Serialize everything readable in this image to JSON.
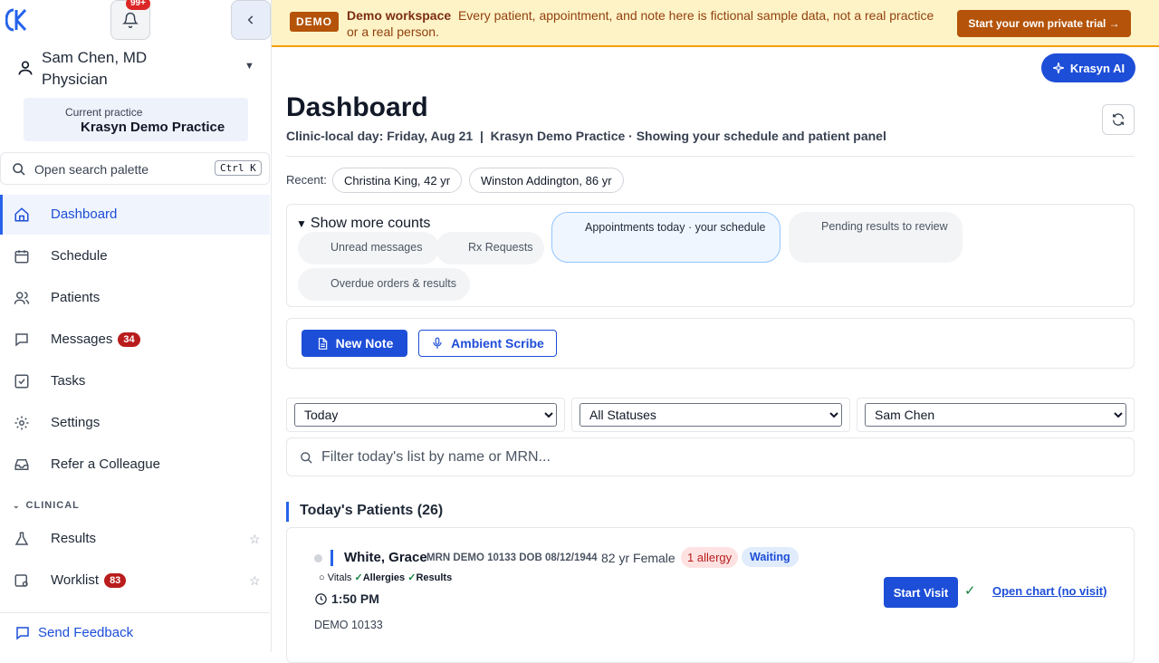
{
  "sidebar": {
    "logo": "K",
    "notif_count": "99+",
    "user_name": "Sam Chen, MD",
    "user_role": "Physician",
    "practice_label": "Current practice",
    "practice_name": "Krasyn Demo Practice",
    "search_label": "Open search palette",
    "search_shortcut": "Ctrl K",
    "nav": [
      {
        "label": "Dashboard",
        "icon": "home-icon",
        "active": true
      },
      {
        "label": "Schedule",
        "icon": "calendar-icon"
      },
      {
        "label": "Patients",
        "icon": "users-icon"
      },
      {
        "label": "Messages",
        "icon": "message-icon",
        "badge": "34"
      },
      {
        "label": "Tasks",
        "icon": "checkbox-icon"
      },
      {
        "label": "Settings",
        "icon": "gear-icon"
      },
      {
        "label": "Refer a Colleague",
        "icon": "inbox-icon"
      }
    ],
    "section_clinical": "CLINICAL",
    "clinical": [
      {
        "label": "Results",
        "icon": "flask-icon"
      },
      {
        "label": "Worklist",
        "icon": "worklist-icon",
        "badge": "83"
      }
    ],
    "feedback": "Send Feedback"
  },
  "banner": {
    "tag": "DEMO",
    "title": "Demo workspace",
    "message": "Every patient, appointment, and note here is fictional sample data, not a real practice or a real person.",
    "cta": "Start your own private trial →"
  },
  "ai_button": "Krasyn AI",
  "header": {
    "title": "Dashboard",
    "subtitle": "Clinic-local day: Friday, Aug 21  |  Krasyn Demo Practice · Showing your schedule and patient panel"
  },
  "recent": {
    "label": "Recent:",
    "items": [
      "Christina King, 42 yr",
      "Winston Addington, 86 yr"
    ]
  },
  "counts": {
    "toggle": "Show more counts",
    "pills": [
      "Unread messages",
      "Rx Requests",
      "Appointments today · your schedule",
      "Pending results to review",
      "Overdue orders & results"
    ]
  },
  "actions": {
    "new_note": "New Note",
    "ambient_scribe": "Ambient Scribe"
  },
  "filters": {
    "date": "Today",
    "status": "All Statuses",
    "provider": "Sam Chen",
    "search_placeholder": "Filter today's list by name or MRN..."
  },
  "patients": {
    "title": "Today's Patients (26)",
    "list": [
      {
        "name": "White, Grace",
        "meta": "MRN DEMO 10133 DOB 08/12/1944",
        "age_sex": "82 yr Female",
        "allergy": "1 allergy",
        "status": "Waiting",
        "checks": {
          "vitals": "Vitals",
          "allergies": "Allergies",
          "results": "Results"
        },
        "time": "1:50 PM",
        "mrn": "DEMO 10133",
        "start_visit": "Start Visit",
        "open_chart": "Open chart (no visit)"
      }
    ]
  },
  "colors": {
    "primary": "#1d4ed8",
    "banner_bg": "#fef3c7",
    "banner_accent": "#b45309",
    "badge_red": "#b91c1c"
  }
}
